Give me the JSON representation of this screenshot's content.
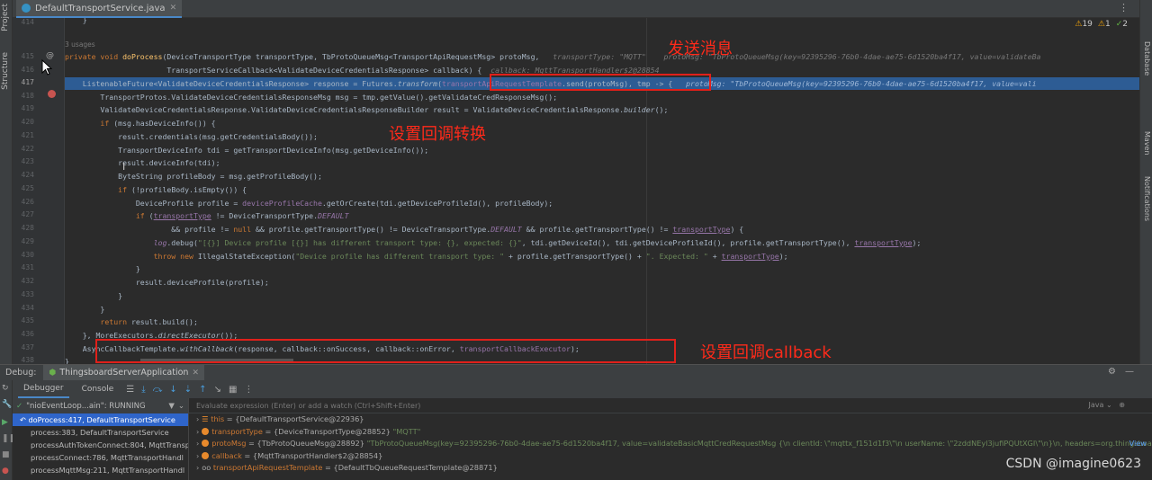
{
  "editor": {
    "file_tab": "DefaultTransportService.java",
    "inspection": {
      "warnings": "19",
      "weak_warnings": "1",
      "ok": "2"
    }
  },
  "side_tabs": {
    "left_top": "Project",
    "left_mid": "Structure"
  },
  "right_tabs": [
    "Database",
    "Maven",
    "Notifications"
  ],
  "gutter": {
    "lines": [
      "414",
      "415",
      "416",
      "417",
      "418",
      "419",
      "420",
      "421",
      "422",
      "423",
      "424",
      "425",
      "426",
      "427",
      "428",
      "429",
      "430",
      "431",
      "432",
      "433",
      "434",
      "435",
      "436",
      "437",
      "438"
    ],
    "current_line": "417"
  },
  "code": {
    "usages": "3 usages",
    "l415": {
      "a": "private void ",
      "fn": "doProcess",
      "b": "(DeviceTransportType transportType, TbProtoQueueMsg<TransportApiRequestMsg> protoMsg,",
      "hint": "   transportType: \"MQTT\"    protoMsg: \"TbProtoQueueMsg(key=92395296-76b0-4dae-ae75-6d1520ba4f17, value=validateBa"
    },
    "l416": {
      "a": "                       TransportServiceCallback<ValidateDeviceCredentialsResponse> callback) {",
      "hint": "  callback: MqttTransportHandler$2@28854"
    },
    "l417": {
      "a": "    ListenableFuture<ValidateDeviceCredentialsResponse> response = Futures.",
      "it": "transform",
      "b": "(",
      "fld": "transportApiRequestTemplate",
      "c": ".send(protoMsg), tmp -> {",
      "hint": "   protoMsg: \"TbProtoQueueMsg(key=92395296-76b0-4dae-ae75-6d1520ba4f17, value=vali"
    },
    "l418": "        TransportProtos.ValidateDeviceCredentialsResponseMsg msg = tmp.getValue().getValidateCredResponseMsg();",
    "l419": {
      "a": "        ValidateDeviceCredentialsResponse.ValidateDeviceCredentialsResponseBuilder result = ValidateDeviceCredentialsResponse.",
      "it": "builder",
      "b": "();"
    },
    "l420": {
      "kw": "        if ",
      "a": "(msg.hasDeviceInfo()) {"
    },
    "l421": "            result.credentials(msg.getCredentialsBody());",
    "l422": "            TransportDeviceInfo tdi = getTransportDeviceInfo(msg.getDeviceInfo());",
    "l423": "            result.deviceInfo(tdi);",
    "l424": "            ByteString profileBody = msg.getProfileBody();",
    "l425": {
      "kw": "            if ",
      "a": "(!profileBody.isEmpty()) {"
    },
    "l426": {
      "a": "                DeviceProfile profile = ",
      "fld": "deviceProfileCache",
      "b": ".getOrCreate(tdi.getDeviceProfileId(), profileBody);"
    },
    "l427": {
      "kw": "                if ",
      "a": "(",
      "ul": "transportType",
      "b": " != DeviceTransportType.",
      "cst": "DEFAULT"
    },
    "l428": {
      "a": "                        && profile != ",
      "kw": "null",
      "b": " && profile.getTransportType() != DeviceTransportType.",
      "cst": "DEFAULT",
      "c": " && profile.getTransportType() != ",
      "ul": "transportType",
      "d": ") {"
    },
    "l429": {
      "fld": "                    log",
      "a": ".debug(",
      "str": "\"[{}] Device profile [{}] has different transport type: {}, expected: {}\"",
      "b": ", tdi.getDeviceId(), tdi.getDeviceProfileId(), profile.getTransportType(), ",
      "ul": "transportType",
      "c": ");"
    },
    "l430": {
      "kw": "                    throw new ",
      "a": "IllegalStateException(",
      "str": "\"Device profile has different transport type: \"",
      "b": " + profile.getTransportType() + ",
      "str2": "\". Expected: \"",
      "c": " + ",
      "ul": "transportType",
      "d": ");"
    },
    "l431": "                }",
    "l432": "                result.deviceProfile(profile);",
    "l433": "            }",
    "l434": "        }",
    "l435": {
      "kw": "        return ",
      "a": "result.build();"
    },
    "l436": {
      "a": "    }, MoreExecutors.",
      "it": "directExecutor",
      "b": "());"
    },
    "l437": {
      "a": "    AsyncCallbackTemplate.",
      "it": "withCallback",
      "b": "(response, callback::onSuccess, callback::onError, ",
      "fld": "transportCallbackExecutor",
      "c": ");"
    },
    "l438": "}"
  },
  "annotations": {
    "send": "发送消息",
    "transform": "设置回调转换",
    "callback": "设置回调callback"
  },
  "debug": {
    "label": "Debug:",
    "run_config": "ThingsboardServerApplication",
    "tabs": [
      "Debugger",
      "Console"
    ],
    "thread": "\"nioEventLoop...ain\": RUNNING",
    "frames": [
      "doProcess:417, DefaultTransportService",
      "process:383, DefaultTransportService",
      "processAuthTokenConnect:804, MqttTransp",
      "processConnect:786, MqttTransportHandl",
      "processMqttMsg:211, MqttTransportHandl"
    ],
    "eval_placeholder": "Evaluate expression (Enter) or add a watch (Ctrl+Shift+Enter)",
    "eval_lang": "Java",
    "variables": [
      {
        "name": "this",
        "type": " = {DefaultTransportService@22936}",
        "value": ""
      },
      {
        "name": "transportType",
        "type": " = {DeviceTransportType@28852} ",
        "value": "\"MQTT\""
      },
      {
        "name": "protoMsg",
        "type": " = {TbProtoQueueMsg@28892} ",
        "value": "\"TbProtoQueueMsg(key=92395296-76b0-4dae-ae75-6d1520ba4f17, value=validateBasicMqttCredRequestMsg {\\n  clientId: \\\"mqttx_f151d1f3\\\"\\n  userName: \\\"2zddNEyl3jufiPQUtXGI\\\"\\n}\\n, headers=org.thingsboard.se..."
      },
      {
        "name": "callback",
        "type": " = {MqttTransportHandler$2@28854}",
        "value": ""
      },
      {
        "name": "transportApiRequestTemplate",
        "type": " = {DefaultTbQueueRequestTemplate@28871}",
        "value": ""
      }
    ],
    "view_link": "View"
  },
  "watermark": "CSDN @imagine0623"
}
